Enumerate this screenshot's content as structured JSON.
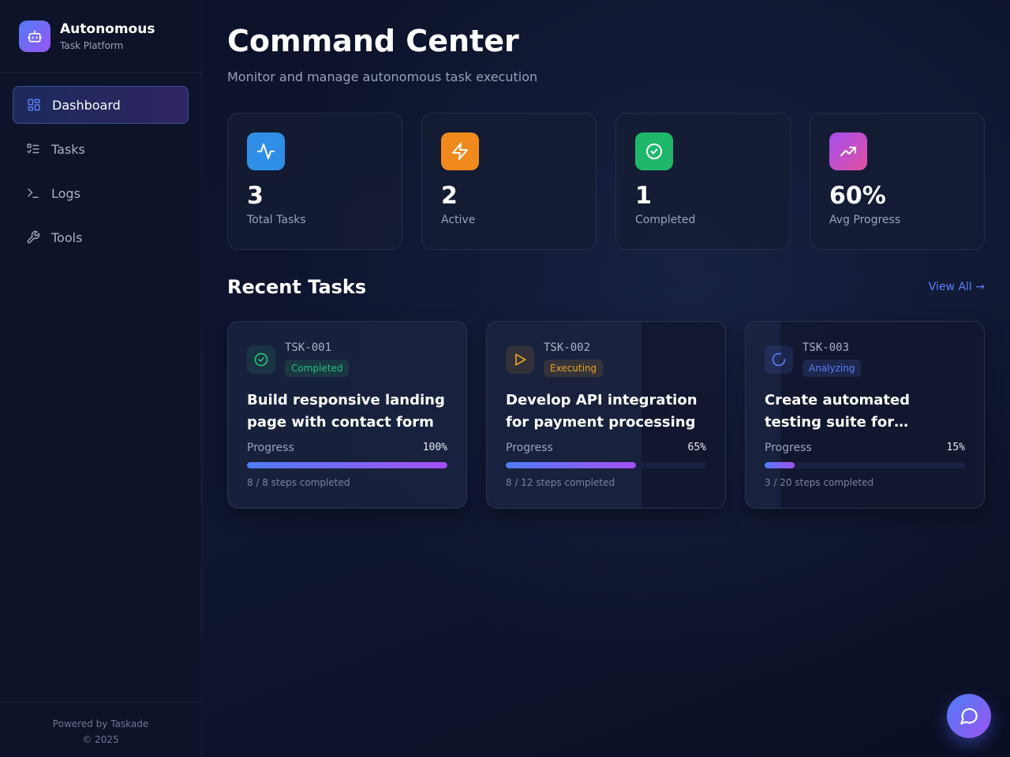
{
  "brand": {
    "title": "Autonomous",
    "subtitle": "Task Platform",
    "icon": "robot-icon"
  },
  "nav": [
    {
      "label": "Dashboard",
      "icon": "dashboard-grid-icon",
      "active": true
    },
    {
      "label": "Tasks",
      "icon": "checklist-icon",
      "active": false
    },
    {
      "label": "Logs",
      "icon": "terminal-icon",
      "active": false
    },
    {
      "label": "Tools",
      "icon": "wrench-icon",
      "active": false
    }
  ],
  "footer": {
    "powered": "Powered by Taskade",
    "copyright": "© 2025"
  },
  "header": {
    "title": "Command Center",
    "subtitle": "Monitor and manage autonomous task execution"
  },
  "stats": [
    {
      "value": "3",
      "label": "Total Tasks",
      "icon": "activity-icon",
      "color": "#2f8fe6"
    },
    {
      "value": "2",
      "label": "Active",
      "icon": "lightning-icon",
      "color": "#f08a1c"
    },
    {
      "value": "1",
      "label": "Completed",
      "icon": "check-circle-icon",
      "color": "#1fb86a"
    },
    {
      "value": "60%",
      "label": "Avg Progress",
      "icon": "trending-up-icon",
      "color": "#c94fd8"
    }
  ],
  "recent": {
    "title": "Recent Tasks",
    "view_all": "View All →"
  },
  "tasks": [
    {
      "id": "TSK-001",
      "status": "Completed",
      "status_color": "#27c07a",
      "icon": "check-circle-icon",
      "title": "Build responsive landing page with contact form",
      "progress_label": "Progress",
      "progress": "100%",
      "progress_value": 1.0,
      "steps": "8 / 8 steps completed"
    },
    {
      "id": "TSK-002",
      "status": "Executing",
      "status_color": "#e6a526",
      "icon": "play-icon",
      "title": "Develop API integration for payment processing",
      "progress_label": "Progress",
      "progress": "65%",
      "progress_value": 0.65,
      "steps": "8 / 12 steps completed"
    },
    {
      "id": "TSK-003",
      "status": "Analyzing",
      "status_color": "#5b7ef5",
      "icon": "spinner-icon",
      "title": "Create automated testing suite for…",
      "progress_label": "Progress",
      "progress": "15%",
      "progress_value": 0.15,
      "steps": "3 / 20 steps completed"
    }
  ],
  "chat": {
    "icon": "chat-bubble-icon"
  }
}
